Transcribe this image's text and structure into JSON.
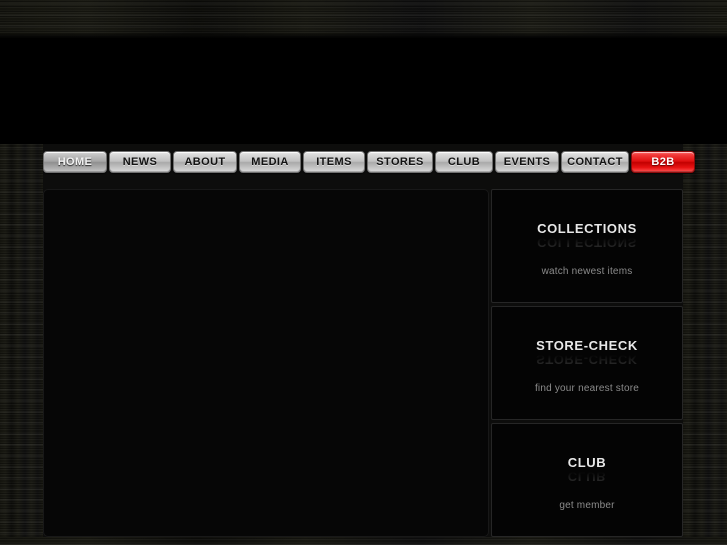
{
  "site": {
    "background_color": "#0d0d0c",
    "accent_color": "#e01010",
    "panel_color": "#040404"
  },
  "header": {
    "logo_area_label": ""
  },
  "nav": {
    "items": [
      {
        "label": "HOME",
        "name": "nav-item-home",
        "state": "active"
      },
      {
        "label": "NEWS",
        "name": "nav-item-news",
        "state": "default"
      },
      {
        "label": "ABOUT",
        "name": "nav-item-about",
        "state": "default"
      },
      {
        "label": "MEDIA",
        "name": "nav-item-media",
        "state": "default"
      },
      {
        "label": "ITEMS",
        "name": "nav-item-items",
        "state": "default"
      },
      {
        "label": "STORES",
        "name": "nav-item-stores",
        "state": "default"
      },
      {
        "label": "CLUB",
        "name": "nav-item-club",
        "state": "default"
      },
      {
        "label": "EVENTS",
        "name": "nav-item-events",
        "state": "default"
      },
      {
        "label": "CONTACT",
        "name": "nav-item-contact",
        "state": "default"
      },
      {
        "label": "B2B",
        "name": "nav-item-b2b",
        "state": "highlight"
      }
    ]
  },
  "main": {
    "content": ""
  },
  "sidebar": {
    "panels": [
      {
        "title": "COLLECTIONS",
        "subtitle": "watch newest items"
      },
      {
        "title": "STORE-CHECK",
        "subtitle": "find your nearest store"
      },
      {
        "title": "CLUB",
        "subtitle": "get member"
      }
    ]
  }
}
